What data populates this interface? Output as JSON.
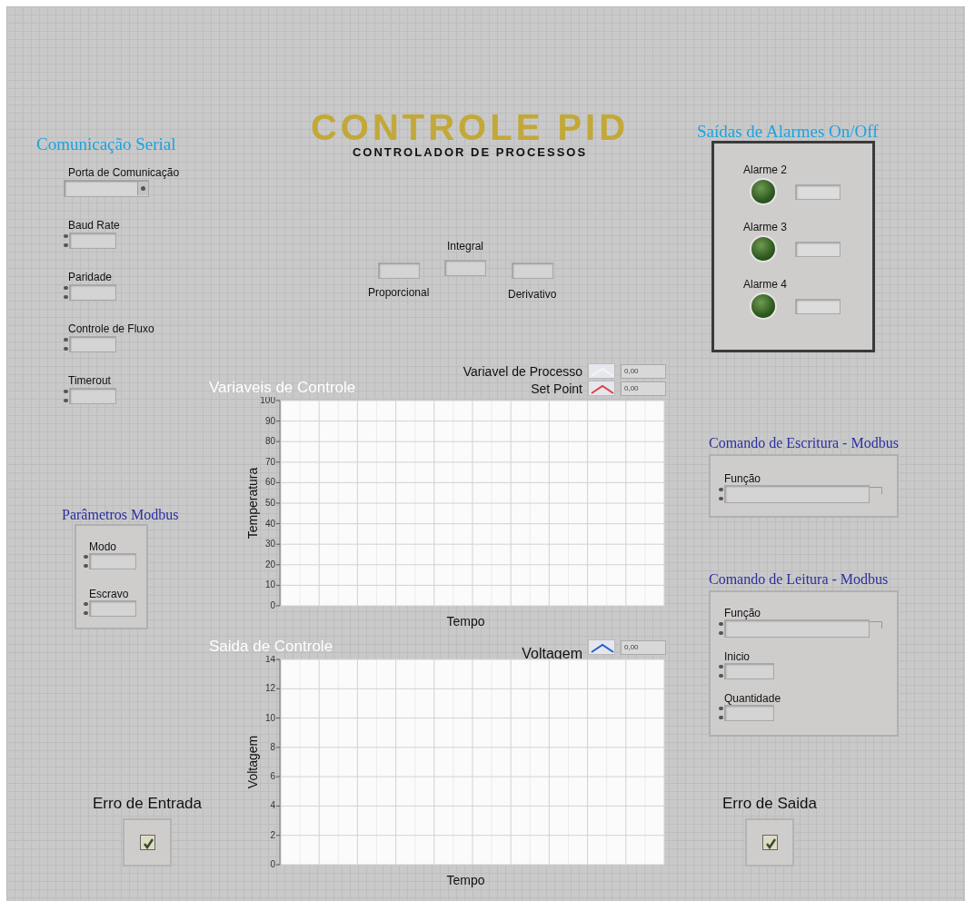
{
  "header": {
    "title": "CONTROLE PID",
    "subtitle": "CONTROLADOR DE PROCESSOS"
  },
  "serial": {
    "heading": "Comunicação Serial",
    "fields": [
      {
        "label": "Porta de Comunicação",
        "kind": "dropdown"
      },
      {
        "label": "Baud Rate",
        "kind": "numeric"
      },
      {
        "label": "Paridade",
        "kind": "numeric"
      },
      {
        "label": "Controle de Fluxo",
        "kind": "numeric"
      },
      {
        "label": "Timerout",
        "kind": "numeric"
      }
    ]
  },
  "pid": {
    "fields": [
      {
        "label": "Proporcional"
      },
      {
        "label": "Integral"
      },
      {
        "label": "Derivativo"
      }
    ]
  },
  "alarms": {
    "heading": "Saídas de Alarmes On/Off",
    "items": [
      {
        "label": "Alarme 2",
        "on": false
      },
      {
        "label": "Alarme 3",
        "on": false
      },
      {
        "label": "Alarme 4",
        "on": false
      }
    ]
  },
  "modbus": {
    "heading": "Parâmetros Modbus",
    "fields": [
      {
        "label": "Modo",
        "kind": "numeric"
      },
      {
        "label": "Escravo",
        "kind": "numeric"
      }
    ]
  },
  "write_command": {
    "heading": "Comando de Escritura - Modbus",
    "fields": [
      {
        "label": "Função",
        "kind": "ring"
      }
    ]
  },
  "read_command": {
    "heading": "Comando de Leitura - Modbus",
    "fields": [
      {
        "label": "Função",
        "kind": "ring"
      },
      {
        "label": "Inicio",
        "kind": "numeric"
      },
      {
        "label": "Quantidade",
        "kind": "numeric"
      }
    ]
  },
  "charts": [
    {
      "title": "Variaveis de Controle",
      "legend": [
        {
          "name": "Variavel de Processo",
          "color": "#f4f4f4",
          "readout": "0,00"
        },
        {
          "name": "Set Point",
          "color": "#e04040",
          "readout": "0,00"
        }
      ],
      "graph": {
        "xlabel": "Tempo",
        "ylabel": "Temperatura",
        "yticks": [
          "100",
          "90",
          "80",
          "70",
          "60",
          "50",
          "40",
          "30",
          "20",
          "10",
          "0"
        ]
      }
    },
    {
      "title": "Saida de Controle",
      "legend": [
        {
          "name": "Voltagem",
          "color": "#2060d0",
          "readout": "0,00"
        }
      ],
      "graph": {
        "xlabel": "Tempo",
        "ylabel": "Voltagem",
        "yticks": [
          "14",
          "12",
          "10",
          "8",
          "6",
          "4",
          "2",
          "0"
        ]
      }
    }
  ],
  "errors": [
    {
      "label": "Erro de Entrada"
    },
    {
      "label": "Erro de Saida"
    }
  ]
}
